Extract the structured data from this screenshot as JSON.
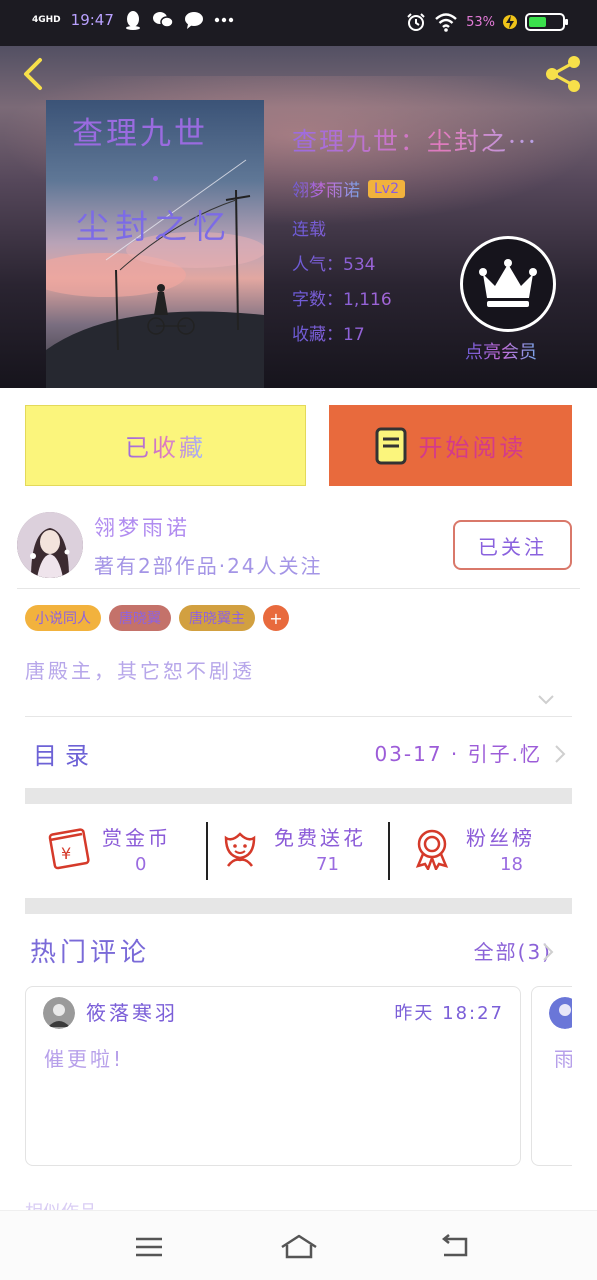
{
  "status_bar": {
    "network": "4GHD",
    "time": "19:47",
    "battery_percent": "53%",
    "battery_level": 0.53,
    "icons": [
      "qq-icon",
      "wechat-icon",
      "message-icon",
      "more-dots-icon",
      "alarm-icon",
      "wifi-icon",
      "charging-icon",
      "battery-icon"
    ]
  },
  "header": {
    "back_icon": "chevron-left-icon",
    "share_icon": "share-icon"
  },
  "book": {
    "cover_title_line1": "查理九世",
    "cover_title_line2": "尘封之忆",
    "title": "查理九世：尘封之···",
    "author": "翎梦雨诺",
    "author_level": "Lv2",
    "status": "连载",
    "popularity": "人气：534",
    "word_count": "字数：1,116",
    "favorites": "收藏：17"
  },
  "vip": {
    "icon": "crown-icon",
    "label": "点亮会员"
  },
  "actions": {
    "collected_label": "已收藏",
    "read_label": "开始阅读",
    "read_icon": "book-icon"
  },
  "author_card": {
    "name": "翎梦雨诺",
    "subtitle": "著有2部作品·24人关注",
    "follow_label": "已关注"
  },
  "tags": [
    {
      "label": "小说同人",
      "color": "#f2b23d"
    },
    {
      "label": "唐晓翼",
      "color": "#c4726a"
    },
    {
      "label": "唐晓翼主",
      "color": "#d2a040"
    },
    {
      "label": "+",
      "color": "#e86a3d"
    }
  ],
  "description": "唐殿主，其它恕不剧透",
  "catalog": {
    "label": "目录",
    "latest": "03-17 · 引子.忆"
  },
  "stats": [
    {
      "label": "赏金币",
      "value": "0",
      "icon": "red-envelope-icon"
    },
    {
      "label": "免费送花",
      "value": "71",
      "icon": "flower-icon"
    },
    {
      "label": "粉丝榜",
      "value": "18",
      "icon": "medal-icon"
    }
  ],
  "hot_comments": {
    "title": "热门评论",
    "all_link": "全部(3)",
    "items": [
      {
        "user": "筱落寒羽",
        "time": "昨天 18:27",
        "text": "催更啦!"
      },
      {
        "user": "",
        "time": "",
        "text": "雨"
      }
    ]
  },
  "more_works_label": "相似作品",
  "nav": {
    "menu_icon": "menu-icon",
    "home_icon": "home-icon",
    "back_icon": "back-arrow-icon"
  },
  "colors": {
    "accent_yellow": "#fbf57c",
    "accent_orange": "#e86a3d",
    "battery_green": "#3be04c"
  }
}
